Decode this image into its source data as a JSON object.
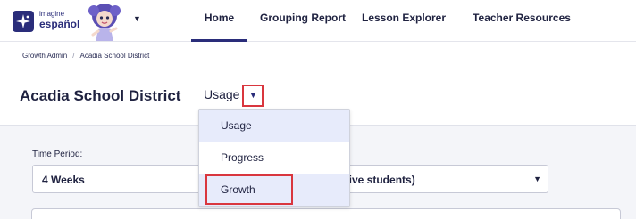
{
  "brand": {
    "small_text": "imagine",
    "name": "español",
    "logo_icon": "sparkle-icon",
    "mascot_icon": "mascot-girl-icon",
    "menu_icon": "chevron-down-icon"
  },
  "nav": {
    "items": [
      {
        "label": "Home",
        "active": true
      },
      {
        "label": "Grouping Report",
        "active": false
      },
      {
        "label": "Lesson Explorer",
        "active": false
      },
      {
        "label": "Teacher Resources",
        "active": false
      }
    ]
  },
  "breadcrumb": {
    "items": [
      "Growth Admin",
      "Acadia School District"
    ],
    "separator": "/"
  },
  "page": {
    "title": "Acadia School District",
    "view_selected": "Usage"
  },
  "view_dropdown": {
    "options": [
      "Usage",
      "Progress",
      "Growth"
    ],
    "highlighted": "Growth"
  },
  "filters": {
    "time_period_label": "Time Period:",
    "time_period_value": "4 Weeks",
    "second_value_visible": "ctive students)"
  },
  "colors": {
    "brand": "#2a2d7a",
    "highlight_border": "#d9363e",
    "option_hover": "#e7ebfb",
    "panel_bg": "#f4f5f9"
  }
}
